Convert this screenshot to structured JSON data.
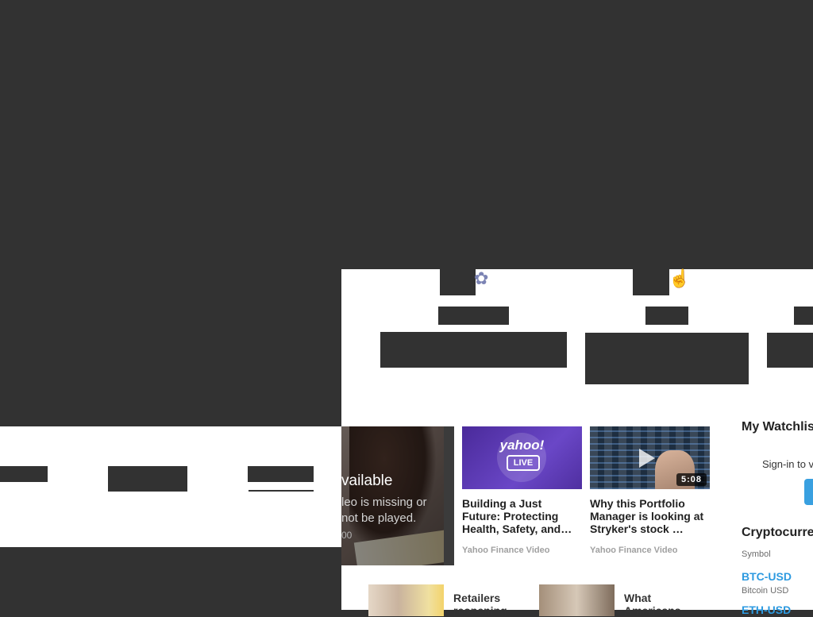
{
  "player": {
    "title": "vailable",
    "message_line1": "leo is missing or",
    "message_line2": "not be played.",
    "code": "00"
  },
  "videos": [
    {
      "title": "Building a Just Future: Protecting Health, Safety, and…",
      "source": "Yahoo Finance Video",
      "logo_text": "yahoo!",
      "badge": "LIVE"
    },
    {
      "title": "Why this Portfolio Manager is looking at Stryker's stock …",
      "source": "Yahoo Finance Video",
      "duration": "5:08"
    }
  ],
  "stories": [
    {
      "title": "Retailers reopening"
    },
    {
      "title": "What Americans"
    }
  ],
  "watchlist": {
    "title": "My Watchlis",
    "signin": "Sign-in to v"
  },
  "crypto": {
    "title": "Cryptocurre",
    "symbol_header": "Symbol",
    "rows": [
      {
        "symbol": "BTC-USD",
        "name": "Bitcoin USD"
      },
      {
        "symbol": "ETH-USD"
      }
    ]
  },
  "colors": {
    "overlay": "#323232",
    "link": "#2d9ae0",
    "purple_tile": "#5a3bb5"
  },
  "icons": [
    "ribbon-icon",
    "hand-icon"
  ]
}
